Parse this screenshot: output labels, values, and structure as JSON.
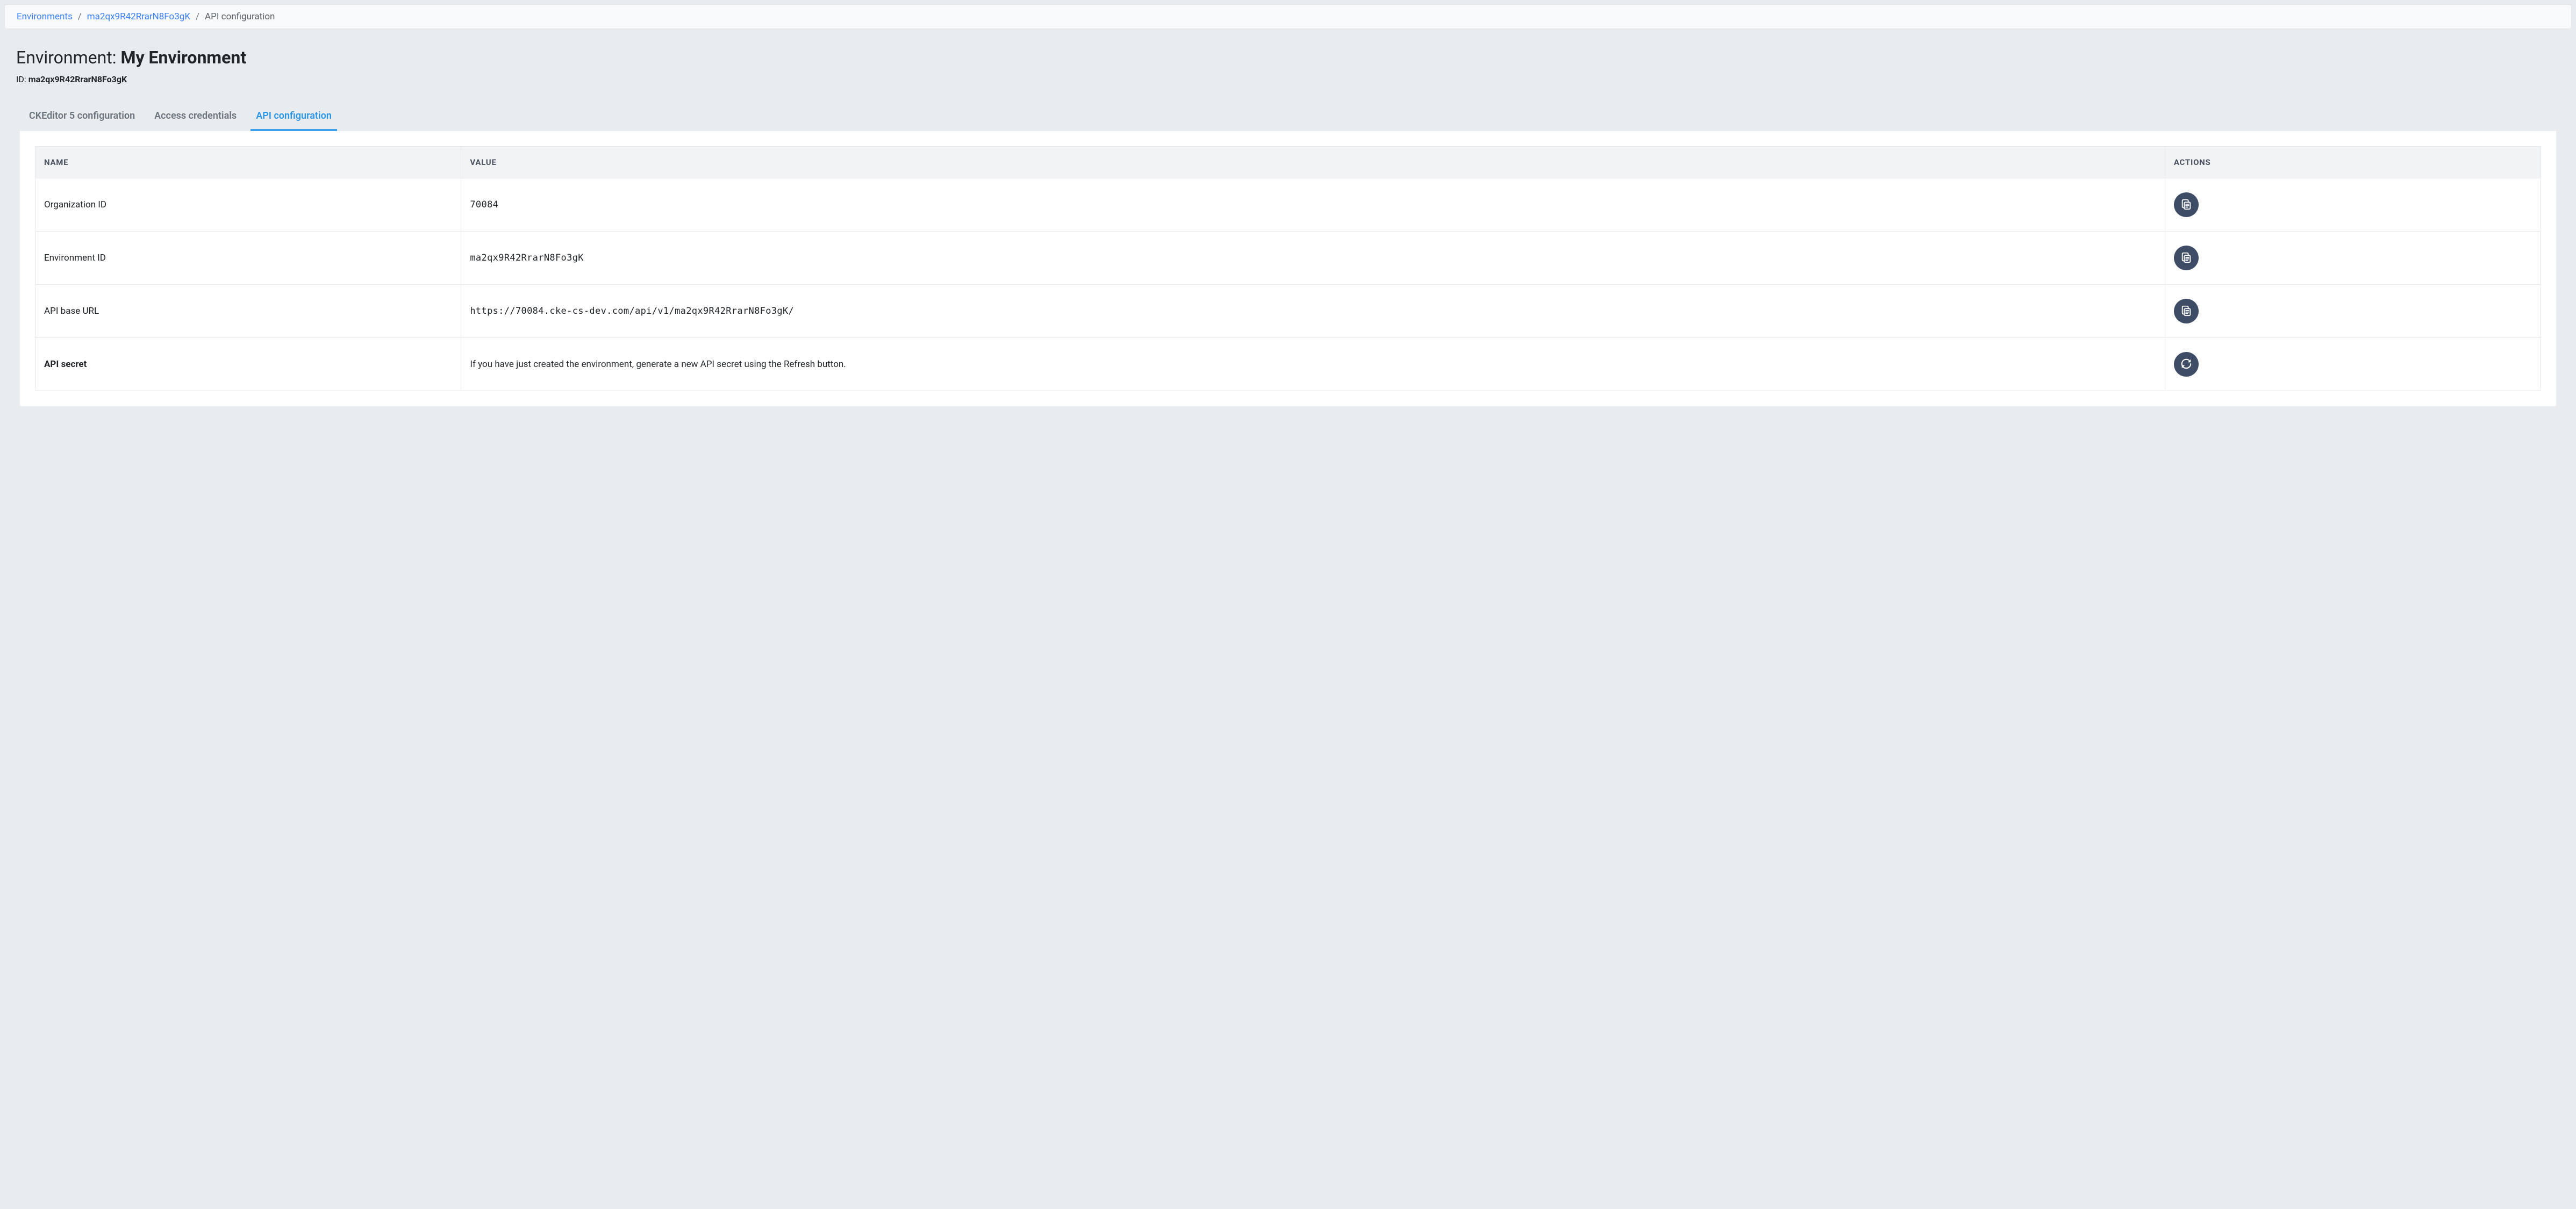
{
  "breadcrumb": {
    "items": [
      {
        "label": "Environments",
        "link": true
      },
      {
        "label": "ma2qx9R42RrarN8Fo3gK",
        "link": true
      },
      {
        "label": "API configuration",
        "link": false
      }
    ]
  },
  "header": {
    "title_prefix": "Environment: ",
    "title_name": "My Environment",
    "id_label": "ID: ",
    "id_value": "ma2qx9R42RrarN8Fo3gK"
  },
  "tabs": [
    {
      "label": "CKEditor 5 configuration",
      "active": false
    },
    {
      "label": "Access credentials",
      "active": false
    },
    {
      "label": "API configuration",
      "active": true
    }
  ],
  "table": {
    "headers": {
      "name": "NAME",
      "value": "VALUE",
      "actions": "ACTIONS"
    },
    "rows": [
      {
        "name": "Organization ID",
        "value": "70084",
        "mono": true,
        "bold": false,
        "action": "copy"
      },
      {
        "name": "Environment ID",
        "value": "ma2qx9R42RrarN8Fo3gK",
        "mono": true,
        "bold": false,
        "action": "copy"
      },
      {
        "name": "API base URL",
        "value": "https://70084.cke-cs-dev.com/api/v1/ma2qx9R42RrarN8Fo3gK/",
        "mono": true,
        "bold": false,
        "action": "copy"
      },
      {
        "name": "API secret",
        "value": "If you have just created the environment, generate a new API secret using the Refresh button.",
        "mono": false,
        "bold": true,
        "action": "refresh"
      }
    ]
  }
}
